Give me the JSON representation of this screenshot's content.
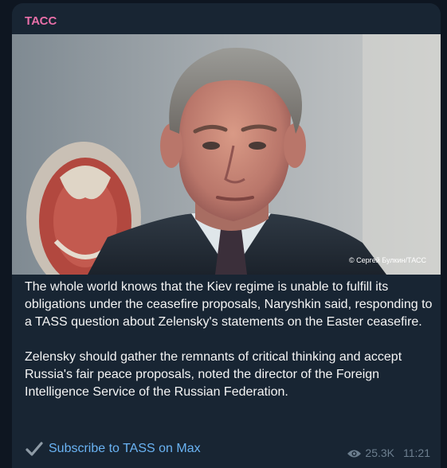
{
  "post": {
    "channel_name": "ТАСС",
    "photo_credit": "© Сергей Булкин/ТАСС",
    "paragraphs": [
      "The whole world knows that the Kiev regime is unable to fulfill its obligations under the ceasefire proposals, Naryshkin said, responding to a TASS question about Zelensky's statements on the Easter ceasefire.",
      "Zelensky should gather the remnants of critical thinking and accept Russia's fair peace proposals, noted the director of the Foreign Intelligence Service of the Russian Federation."
    ],
    "subscribe_label": "Subscribe to TASS on Max",
    "views": "25.3K",
    "time": "11:21"
  },
  "icons": {
    "check": "check-icon",
    "views": "eye-icon"
  },
  "colors": {
    "background": "#0e1621",
    "bubble": "#182533",
    "channel_name": "#e86fa8",
    "link": "#6ab3f3",
    "meta": "#6d7f8f",
    "text": "#f5f5f5"
  }
}
